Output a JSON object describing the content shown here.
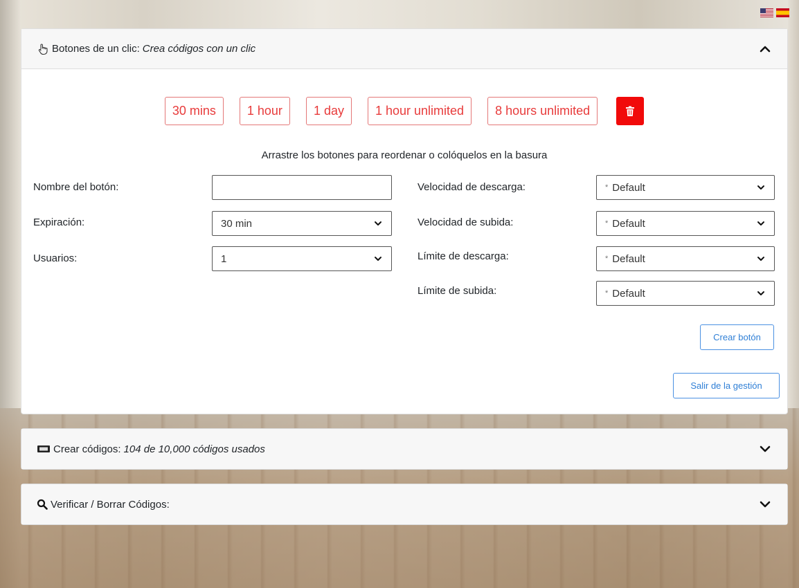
{
  "flags": {
    "us_icon": "us-flag-icon",
    "es_icon": "spain-flag-icon"
  },
  "panel1": {
    "title": "Botones de un clic:",
    "subtitle": "Crea códigos con un clic",
    "presets": [
      "30 mins",
      "1 hour",
      "1 day",
      "1 hour unlimited",
      "8 hours unlimited"
    ],
    "drag_hint": "Arrastre los botones para reordenar o colóquelos en la basura",
    "form": {
      "name_label": "Nombre del botón:",
      "name_value": "",
      "expiration_label": "Expiración:",
      "expiration_value": "30 min",
      "users_label": "Usuarios:",
      "users_value": "1",
      "download_speed_label": "Velocidad de descarga:",
      "download_speed_value": "Default",
      "upload_speed_label": "Velocidad de subida:",
      "upload_speed_value": "Default",
      "download_limit_label": "Límite de descarga:",
      "download_limit_value": "Default",
      "upload_limit_label": "Límite de subida:",
      "upload_limit_value": "Default",
      "default_marker": "*"
    },
    "create_button": "Crear botón",
    "exit_button": "Salir de la gestión"
  },
  "panel2": {
    "title": "Crear códigos:",
    "subtitle": "104 de 10,000 códigos usados"
  },
  "panel3": {
    "title": "Verificar / Borrar Códigos:"
  },
  "colors": {
    "preset_red": "#e83b3b",
    "trash_red": "#f10a0a",
    "accent_blue": "#4a90e2"
  }
}
